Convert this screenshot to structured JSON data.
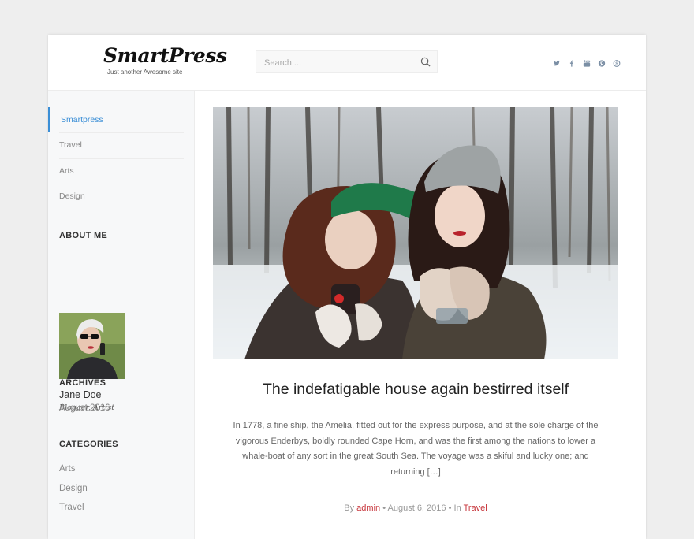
{
  "header": {
    "site_title": "SmartPress",
    "tagline": "Just another Awesome site",
    "search_placeholder": "Search ...",
    "social_icons": [
      "twitter-icon",
      "facebook-icon",
      "youtube-icon",
      "pinterest-icon",
      "skype-icon"
    ]
  },
  "sidebar": {
    "nav": [
      {
        "label": "Smartpress",
        "active": true
      },
      {
        "label": "Travel",
        "active": false
      },
      {
        "label": "Arts",
        "active": false
      },
      {
        "label": "Design",
        "active": false
      }
    ],
    "about_title": "ABOUT ME",
    "author_name": "Jane Doe",
    "author_role": "Blogger, Artist",
    "archives_title": "ARCHIVES",
    "archives": [
      "August 2016"
    ],
    "categories_title": "CATEGORIES",
    "categories": [
      "Arts",
      "Design",
      "Travel"
    ]
  },
  "post": {
    "title": "The indefatigable house again bestirred itself",
    "excerpt": "In 1778, a fine ship, the Amelia, fitted out for the express purpose, and at the sole charge of the vigorous Enderbys, boldly rounded Cape Horn, and was the first among the nations to lower a whale-boat of any sort in the great South Sea. The voyage was a skiful and lucky one; and returning […]",
    "meta": {
      "by": "By",
      "author": "admin",
      "sep1": "•",
      "date": "August 6, 2016",
      "sep2": "•",
      "in": "In",
      "category": "Travel"
    }
  },
  "colors": {
    "accent_blue": "#3a8ed6",
    "link_red": "#c7343a"
  }
}
